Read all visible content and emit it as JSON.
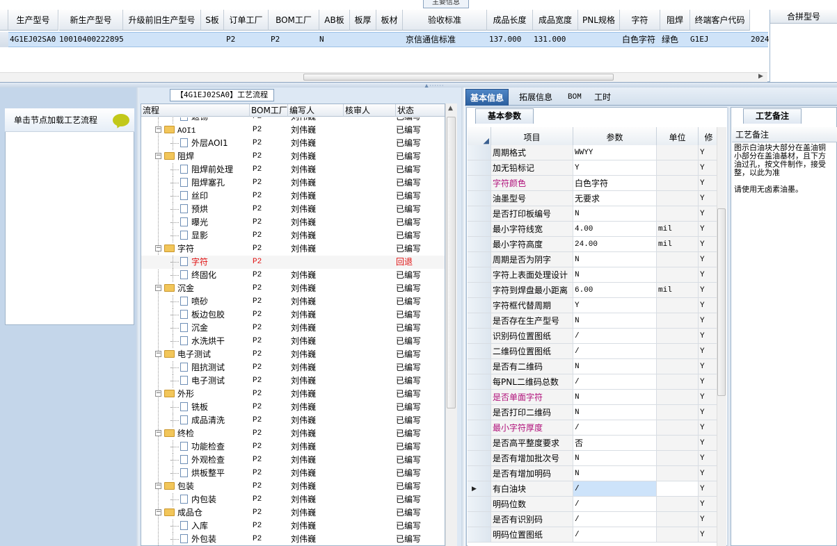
{
  "top": {
    "caption": "主要信息",
    "columns": [
      "生产型号",
      "新生产型号",
      "升级前旧生产型号",
      "S板",
      "订单工厂",
      "BOM工厂",
      "AB板",
      "板厚",
      "板材",
      "验收标准",
      "成品长度",
      "成品宽度",
      "PNL规格",
      "字符",
      "阻焊",
      "终端客户代码"
    ],
    "row": [
      "4G1EJ02SA0",
      "10010400222895",
      "",
      "",
      "P2",
      "P2",
      "N",
      "",
      "",
      "京信通信标准",
      "137.000",
      "131.000",
      "",
      "白色字符",
      "绿色",
      "G1EJ",
      "2024"
    ],
    "merge_header": "合拼型号"
  },
  "left": {
    "load_label": "单击节点加载工艺流程"
  },
  "flow": {
    "title": "【4G1EJ02SA0】工艺流程",
    "columns": [
      "流程",
      "BOM工厂",
      "编写人",
      "核审人",
      "状态"
    ],
    "rows": [
      {
        "name": "返钖",
        "level": 2,
        "bom": "P2",
        "writer": "刘伟巍",
        "status": "已编写",
        "type": "doc"
      },
      {
        "name": "AOI1",
        "level": 1,
        "bom": "P2",
        "writer": "刘伟巍",
        "status": "已编写",
        "type": "folder"
      },
      {
        "name": "外层AOI1",
        "level": 2,
        "bom": "P2",
        "writer": "刘伟巍",
        "status": "已编写",
        "type": "doc"
      },
      {
        "name": "阻焊",
        "level": 1,
        "bom": "P2",
        "writer": "刘伟巍",
        "status": "已编写",
        "type": "folder"
      },
      {
        "name": "阻焊前处理",
        "level": 2,
        "bom": "P2",
        "writer": "刘伟巍",
        "status": "已编写",
        "type": "doc"
      },
      {
        "name": "阻焊塞孔",
        "level": 2,
        "bom": "P2",
        "writer": "刘伟巍",
        "status": "已编写",
        "type": "doc"
      },
      {
        "name": "丝印",
        "level": 2,
        "bom": "P2",
        "writer": "刘伟巍",
        "status": "已编写",
        "type": "doc"
      },
      {
        "name": "预烘",
        "level": 2,
        "bom": "P2",
        "writer": "刘伟巍",
        "status": "已编写",
        "type": "doc"
      },
      {
        "name": "曝光",
        "level": 2,
        "bom": "P2",
        "writer": "刘伟巍",
        "status": "已编写",
        "type": "doc"
      },
      {
        "name": "显影",
        "level": 2,
        "bom": "P2",
        "writer": "刘伟巍",
        "status": "已编写",
        "type": "doc"
      },
      {
        "name": "字符",
        "level": 1,
        "bom": "P2",
        "writer": "刘伟巍",
        "status": "已编写",
        "type": "folder"
      },
      {
        "name": "字符",
        "level": 2,
        "bom": "P2",
        "writer": "",
        "status": "回退",
        "type": "doc",
        "red": true
      },
      {
        "name": "终固化",
        "level": 2,
        "bom": "P2",
        "writer": "刘伟巍",
        "status": "已编写",
        "type": "doc"
      },
      {
        "name": "沉金",
        "level": 1,
        "bom": "P2",
        "writer": "刘伟巍",
        "status": "已编写",
        "type": "folder"
      },
      {
        "name": "喷砂",
        "level": 2,
        "bom": "P2",
        "writer": "刘伟巍",
        "status": "已编写",
        "type": "doc"
      },
      {
        "name": "板边包胶",
        "level": 2,
        "bom": "P2",
        "writer": "刘伟巍",
        "status": "已编写",
        "type": "doc"
      },
      {
        "name": "沉金",
        "level": 2,
        "bom": "P2",
        "writer": "刘伟巍",
        "status": "已编写",
        "type": "doc"
      },
      {
        "name": "水洗烘干",
        "level": 2,
        "bom": "P2",
        "writer": "刘伟巍",
        "status": "已编写",
        "type": "doc"
      },
      {
        "name": "电子测试",
        "level": 1,
        "bom": "P2",
        "writer": "刘伟巍",
        "status": "已编写",
        "type": "folder"
      },
      {
        "name": "阻抗测试",
        "level": 2,
        "bom": "P2",
        "writer": "刘伟巍",
        "status": "已编写",
        "type": "doc"
      },
      {
        "name": "电子测试",
        "level": 2,
        "bom": "P2",
        "writer": "刘伟巍",
        "status": "已编写",
        "type": "doc"
      },
      {
        "name": "外形",
        "level": 1,
        "bom": "P2",
        "writer": "刘伟巍",
        "status": "已编写",
        "type": "folder"
      },
      {
        "name": "铣板",
        "level": 2,
        "bom": "P2",
        "writer": "刘伟巍",
        "status": "已编写",
        "type": "doc"
      },
      {
        "name": "成品清洗",
        "level": 2,
        "bom": "P2",
        "writer": "刘伟巍",
        "status": "已编写",
        "type": "doc"
      },
      {
        "name": "终检",
        "level": 1,
        "bom": "P2",
        "writer": "刘伟巍",
        "status": "已编写",
        "type": "folder"
      },
      {
        "name": "功能检查",
        "level": 2,
        "bom": "P2",
        "writer": "刘伟巍",
        "status": "已编写",
        "type": "doc"
      },
      {
        "name": "外观检查",
        "level": 2,
        "bom": "P2",
        "writer": "刘伟巍",
        "status": "已编写",
        "type": "doc"
      },
      {
        "name": "烘板整平",
        "level": 2,
        "bom": "P2",
        "writer": "刘伟巍",
        "status": "已编写",
        "type": "doc"
      },
      {
        "name": "包装",
        "level": 1,
        "bom": "P2",
        "writer": "刘伟巍",
        "status": "已编写",
        "type": "folder"
      },
      {
        "name": "内包装",
        "level": 2,
        "bom": "P2",
        "writer": "刘伟巍",
        "status": "已编写",
        "type": "doc"
      },
      {
        "name": "成品仓",
        "level": 1,
        "bom": "P2",
        "writer": "刘伟巍",
        "status": "已编写",
        "type": "folder"
      },
      {
        "name": "入库",
        "level": 2,
        "bom": "P2",
        "writer": "刘伟巍",
        "status": "已编写",
        "type": "doc"
      },
      {
        "name": "外包装",
        "level": 2,
        "bom": "P2",
        "writer": "刘伟巍",
        "status": "已编写",
        "type": "doc"
      }
    ]
  },
  "right": {
    "tabs": [
      "基本信息",
      "拓展信息",
      "BOM",
      "工时"
    ],
    "section_title": "基本参数",
    "columns": [
      "项目",
      "参数",
      "单位",
      "修"
    ],
    "rows": [
      {
        "item": "周期格式",
        "value": "WWYY",
        "unit": "",
        "flag": "Y"
      },
      {
        "item": "加无铅标记",
        "value": "Y",
        "unit": "",
        "flag": "Y"
      },
      {
        "item": "字符颜色",
        "value": "白色字符",
        "unit": "",
        "flag": "Y",
        "pink": true
      },
      {
        "item": "油墨型号",
        "value": "无要求",
        "unit": "",
        "flag": "Y"
      },
      {
        "item": "是否打印板编号",
        "value": "N",
        "unit": "",
        "flag": "Y"
      },
      {
        "item": "最小字符线宽",
        "value": "4.00",
        "unit": "mil",
        "flag": "Y"
      },
      {
        "item": "最小字符高度",
        "value": "24.00",
        "unit": "mil",
        "flag": "Y"
      },
      {
        "item": "周期是否为阴字",
        "value": "N",
        "unit": "",
        "flag": "Y"
      },
      {
        "item": "字符上表面处理设计",
        "value": "N",
        "unit": "",
        "flag": "Y"
      },
      {
        "item": "字符到焊盘最小距离",
        "value": "6.00",
        "unit": "mil",
        "flag": "Y"
      },
      {
        "item": "字符框代替周期",
        "value": "Y",
        "unit": "",
        "flag": "Y"
      },
      {
        "item": "是否存在生产型号",
        "value": "N",
        "unit": "",
        "flag": "Y"
      },
      {
        "item": "识别码位置图纸",
        "value": "/",
        "unit": "",
        "flag": "Y"
      },
      {
        "item": "二维码位置图纸",
        "value": "/",
        "unit": "",
        "flag": "Y"
      },
      {
        "item": "是否有二维码",
        "value": "N",
        "unit": "",
        "flag": "Y"
      },
      {
        "item": "每PNL二维码总数",
        "value": "/",
        "unit": "",
        "flag": "Y"
      },
      {
        "item": "是否单面字符",
        "value": "N",
        "unit": "",
        "flag": "Y",
        "pink": true
      },
      {
        "item": "是否打印二维码",
        "value": "N",
        "unit": "",
        "flag": "Y"
      },
      {
        "item": "最小字符厚度",
        "value": "/",
        "unit": "",
        "flag": "Y",
        "pink": true
      },
      {
        "item": "是否高平整度要求",
        "value": "否",
        "unit": "",
        "flag": "Y"
      },
      {
        "item": "是否有增加批次号",
        "value": "N",
        "unit": "",
        "flag": "Y"
      },
      {
        "item": "是否有增加明码",
        "value": "N",
        "unit": "",
        "flag": "Y"
      },
      {
        "item": "有白油块",
        "value": "/",
        "unit": "",
        "flag": "Y",
        "current": true
      },
      {
        "item": "明码位数",
        "value": "/",
        "unit": "",
        "flag": "Y"
      },
      {
        "item": "是否有识别码",
        "value": "/",
        "unit": "",
        "flag": "Y"
      },
      {
        "item": "明码位置图纸",
        "value": "/",
        "unit": "",
        "flag": "Y"
      }
    ],
    "note_title": "工艺备注",
    "note_header": "工艺备注",
    "note_text": "图示白油块大部分在盖油铜\n小部分在盖油基材，且下方\n油过孔，按文件制作，接受\n整，以此为准\n\n请使用无卤素油墨。"
  }
}
